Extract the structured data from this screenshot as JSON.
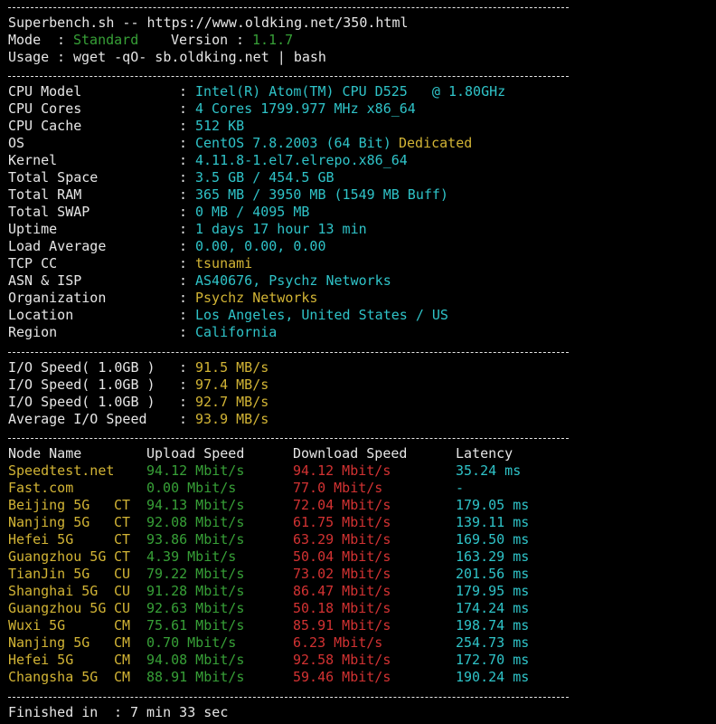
{
  "header": {
    "title_line": "Superbench.sh -- https://www.oldking.net/350.html",
    "mode_label": "Mode",
    "mode_value": "Standard",
    "version_label": "Version",
    "version_value": "1.1.7",
    "usage_label": "Usage",
    "usage_value": "wget -qO- sb.oldking.net | bash"
  },
  "sysinfo": [
    {
      "label": "CPU Model",
      "value": "Intel(R) Atom(TM) CPU D525   @ 1.80GHz",
      "extra": ""
    },
    {
      "label": "CPU Cores",
      "value": "4 Cores 1799.977 MHz x86_64",
      "extra": ""
    },
    {
      "label": "CPU Cache",
      "value": "512 KB",
      "extra": ""
    },
    {
      "label": "OS",
      "value": "CentOS 7.8.2003 (64 Bit)",
      "extra": "Dedicated"
    },
    {
      "label": "Kernel",
      "value": "4.11.8-1.el7.elrepo.x86_64",
      "extra": ""
    },
    {
      "label": "Total Space",
      "value": "3.5 GB / 454.5 GB",
      "extra": ""
    },
    {
      "label": "Total RAM",
      "value": "365 MB / 3950 MB (1549 MB Buff)",
      "extra": ""
    },
    {
      "label": "Total SWAP",
      "value": "0 MB / 4095 MB",
      "extra": ""
    },
    {
      "label": "Uptime",
      "value": "1 days 17 hour 13 min",
      "extra": ""
    },
    {
      "label": "Load Average",
      "value": "0.00, 0.00, 0.00",
      "extra": ""
    },
    {
      "label": "TCP CC",
      "value": "tsunami",
      "extra": ""
    },
    {
      "label": "ASN & ISP",
      "value": "AS40676, Psychz Networks",
      "extra": ""
    },
    {
      "label": "Organization",
      "value": "Psychz Networks",
      "extra": ""
    },
    {
      "label": "Location",
      "value": "Los Angeles, United States / US",
      "extra": ""
    },
    {
      "label": "Region",
      "value": "California",
      "extra": ""
    }
  ],
  "sysinfo_colors": [
    "cyan",
    "cyan",
    "cyan",
    "cyan",
    "cyan",
    "cyan",
    "cyan",
    "cyan",
    "cyan",
    "cyan",
    "yellow",
    "cyan",
    "yellow",
    "cyan",
    "cyan"
  ],
  "io": [
    {
      "label": "I/O Speed( 1.0GB )",
      "value": "91.5 MB/s"
    },
    {
      "label": "I/O Speed( 1.0GB )",
      "value": "97.4 MB/s"
    },
    {
      "label": "I/O Speed( 1.0GB )",
      "value": "92.7 MB/s"
    },
    {
      "label": "Average I/O Speed",
      "value": "93.9 MB/s"
    }
  ],
  "speed_headers": {
    "node": "Node Name",
    "upload": "Upload Speed",
    "download": "Download Speed",
    "latency": "Latency"
  },
  "speed": [
    {
      "node": "Speedtest.net",
      "isp": "",
      "upload": "94.12 Mbit/s",
      "download": "94.12 Mbit/s",
      "latency": "35.24 ms"
    },
    {
      "node": "Fast.com",
      "isp": "",
      "upload": "0.00 Mbit/s",
      "download": "77.0 Mbit/s",
      "latency": "-"
    },
    {
      "node": "Beijing 5G",
      "isp": "CT",
      "upload": "94.13 Mbit/s",
      "download": "72.04 Mbit/s",
      "latency": "179.05 ms"
    },
    {
      "node": "Nanjing 5G",
      "isp": "CT",
      "upload": "92.08 Mbit/s",
      "download": "61.75 Mbit/s",
      "latency": "139.11 ms"
    },
    {
      "node": "Hefei 5G",
      "isp": "CT",
      "upload": "93.86 Mbit/s",
      "download": "63.29 Mbit/s",
      "latency": "169.50 ms"
    },
    {
      "node": "Guangzhou 5G",
      "isp": "CT",
      "upload": "4.39 Mbit/s",
      "download": "50.04 Mbit/s",
      "latency": "163.29 ms"
    },
    {
      "node": "TianJin 5G",
      "isp": "CU",
      "upload": "79.22 Mbit/s",
      "download": "73.02 Mbit/s",
      "latency": "201.56 ms"
    },
    {
      "node": "Shanghai 5G",
      "isp": "CU",
      "upload": "91.28 Mbit/s",
      "download": "86.47 Mbit/s",
      "latency": "179.95 ms"
    },
    {
      "node": "Guangzhou 5G",
      "isp": "CU",
      "upload": "92.63 Mbit/s",
      "download": "50.18 Mbit/s",
      "latency": "174.24 ms"
    },
    {
      "node": "Wuxi 5G",
      "isp": "CM",
      "upload": "75.61 Mbit/s",
      "download": "85.91 Mbit/s",
      "latency": "198.74 ms"
    },
    {
      "node": "Nanjing 5G",
      "isp": "CM",
      "upload": "0.70 Mbit/s",
      "download": "6.23 Mbit/s",
      "latency": "254.73 ms"
    },
    {
      "node": "Hefei 5G",
      "isp": "CM",
      "upload": "94.08 Mbit/s",
      "download": "92.58 Mbit/s",
      "latency": "172.70 ms"
    },
    {
      "node": "Changsha 5G",
      "isp": "CM",
      "upload": "88.91 Mbit/s",
      "download": "59.46 Mbit/s",
      "latency": "190.24 ms"
    }
  ],
  "footer": {
    "finished_label": "Finished in",
    "finished_value": "7 min 33 sec"
  },
  "colors": {
    "background": "#000000",
    "text": "#e6e6e6",
    "green": "#37a037",
    "cyan": "#2fc3c8",
    "yellow": "#d2b435",
    "red": "#d23232"
  }
}
